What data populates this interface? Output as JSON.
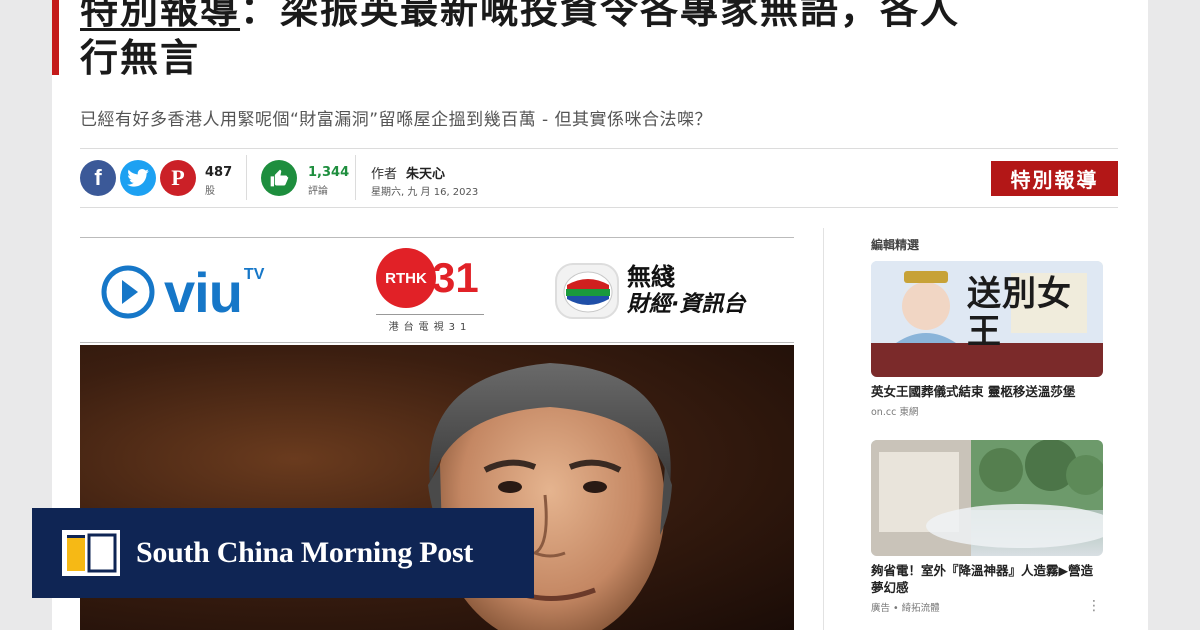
{
  "headline": {
    "tag": "特別報導",
    "separator": "：",
    "line1_rest": "梁振英最新嘅投資令各專家無語，各人",
    "line2": "行無言"
  },
  "subtitle": "已經有好多香港人用緊呢個“財富漏洞”留喺屋企搵到幾百萬 - 但其實係咪合法㗎？",
  "share_bar": {
    "facebook_icon": "facebook-icon",
    "twitter_icon": "twitter-icon",
    "pinterest_icon": "pinterest-icon",
    "shares_count": "487",
    "shares_label": "股",
    "likes_count": "1,344",
    "likes_label": "評論",
    "author_label": "作者",
    "author_name": "朱天心",
    "date": "星期六, 九 月 16, 2023",
    "badge": "特別報導"
  },
  "logos": {
    "viu": "viu",
    "viu_tv": "TV",
    "rthk": "RTHK",
    "rthk_num": "31",
    "rthk_sub": "港台電視31",
    "tvb_line1": "無綫",
    "tvb_line2": "財經·資訊台"
  },
  "sidebar": {
    "title": "編輯精選",
    "items": [
      {
        "thumb_text": "送別女王",
        "title": "英女王國葬儀式結束 靈柩移送溫莎堡",
        "source": "on.cc 東網"
      },
      {
        "title": "夠省電！室外『降溫神器』人造霧▶營造夢幻感",
        "source": "廣告 • 綺拓流體",
        "more": "⋮"
      }
    ]
  },
  "overlay": {
    "brand": "South China Morning Post"
  },
  "colors": {
    "accent_red": "#b31717",
    "brand_navy": "#0f2554",
    "like_green": "#1e8e3e",
    "facebook": "#3b5998",
    "twitter": "#1da1f2",
    "pinterest": "#cb2027"
  }
}
